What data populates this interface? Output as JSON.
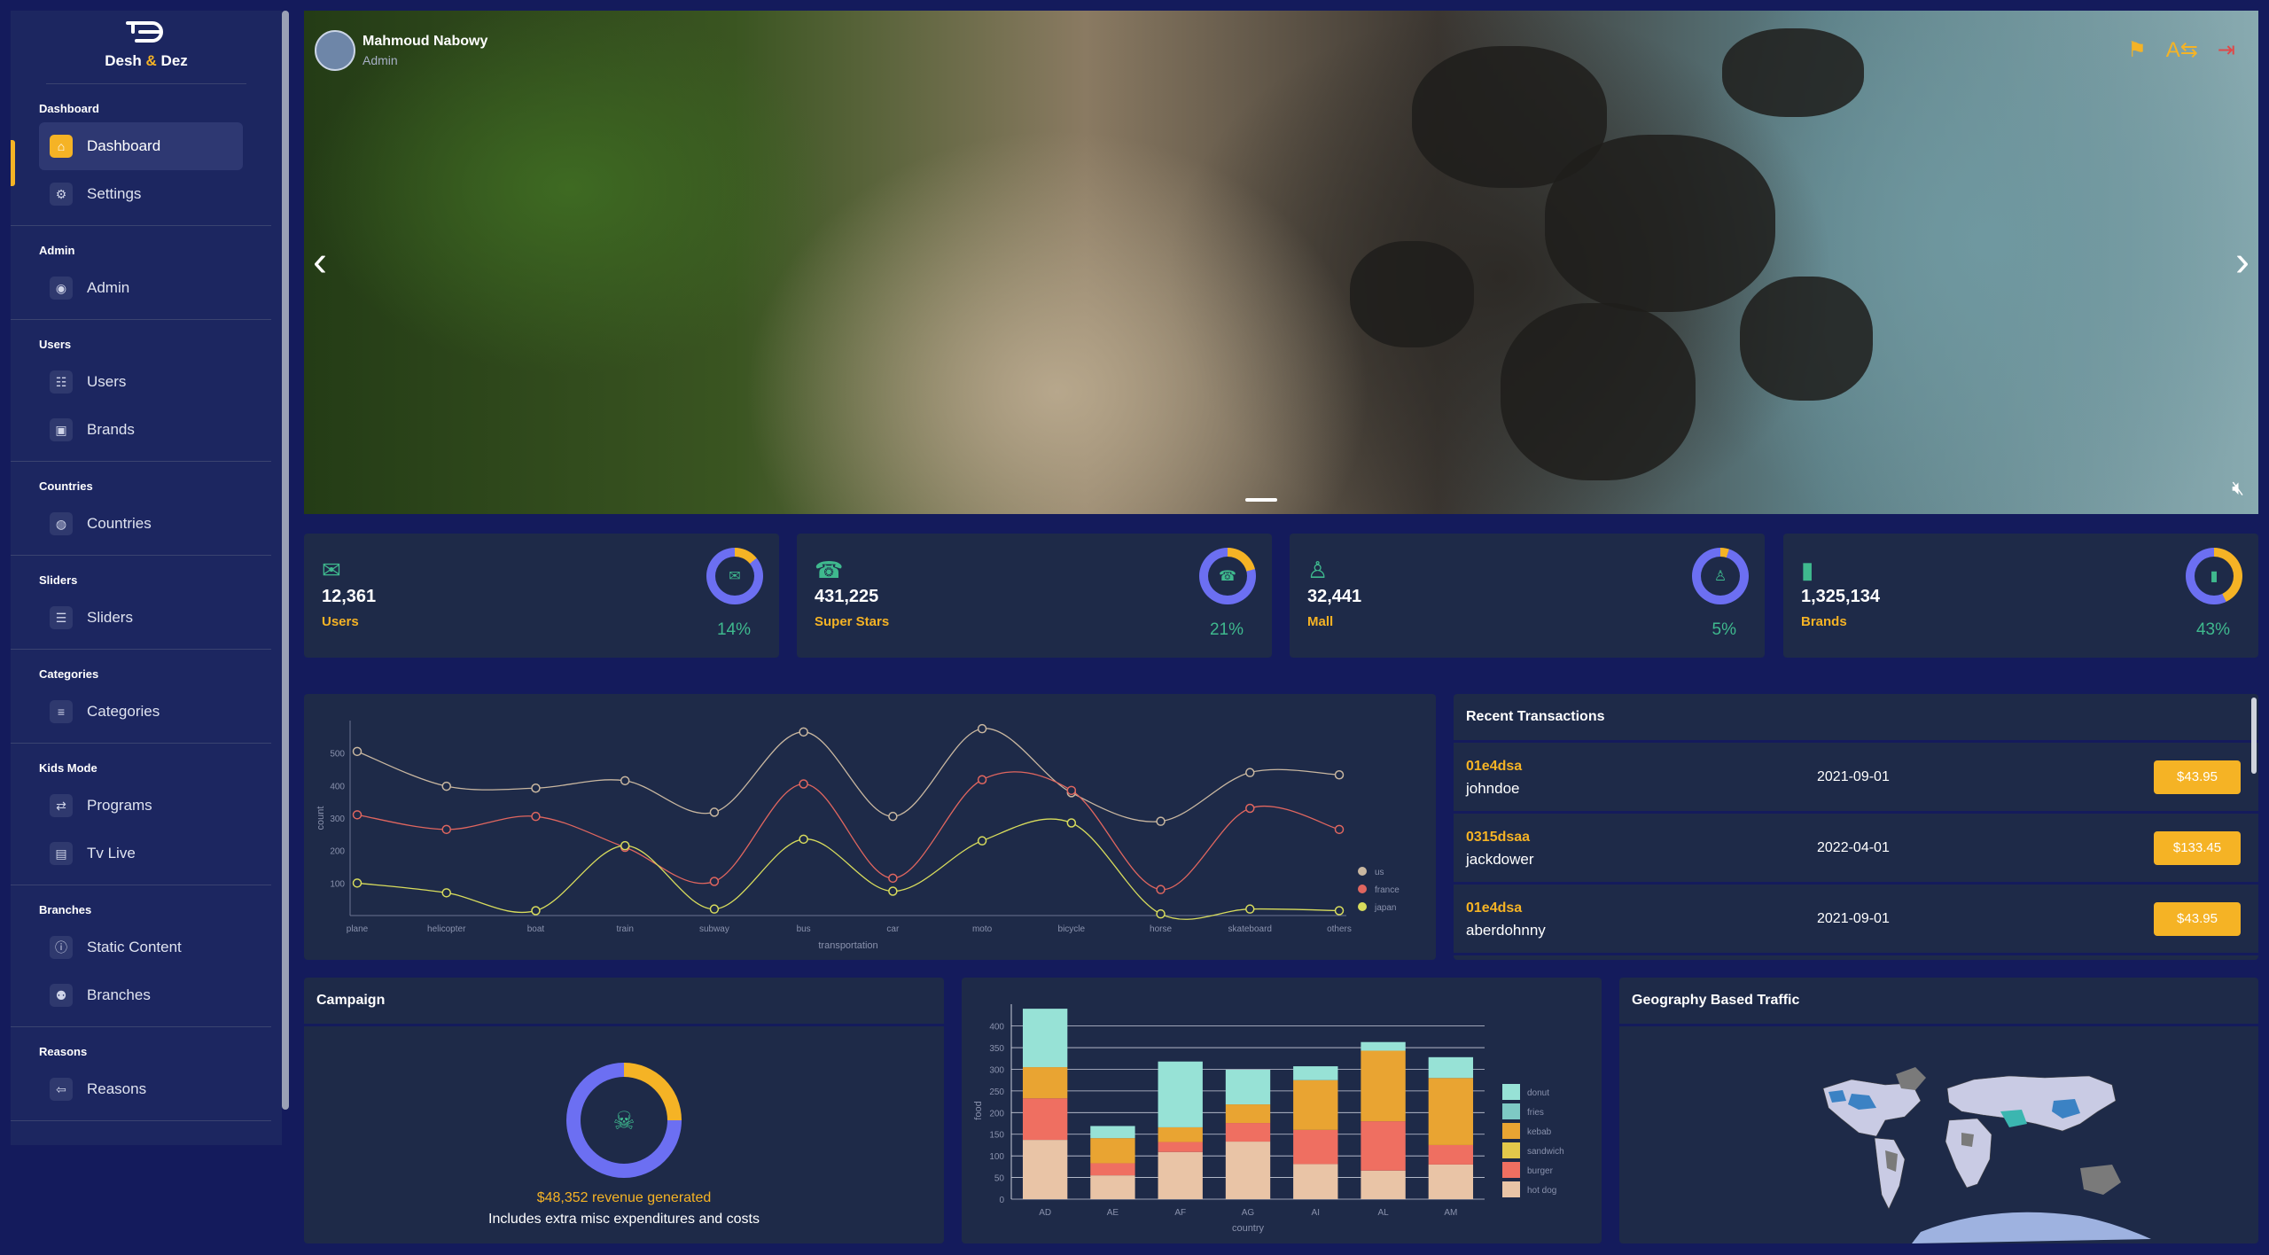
{
  "brand": {
    "name_a": "Desh",
    "amp": "&",
    "name_b": "Dez"
  },
  "sidebar": {
    "sections": [
      {
        "title": "Dashboard",
        "items": [
          {
            "label": "Dashboard",
            "icon": "home-icon"
          },
          {
            "label": "Settings",
            "icon": "gears-icon"
          }
        ]
      },
      {
        "title": "Admin",
        "items": [
          {
            "label": "Admin",
            "icon": "user-icon"
          }
        ]
      },
      {
        "title": "Users",
        "items": [
          {
            "label": "Users",
            "icon": "users-icon"
          },
          {
            "label": "Brands",
            "icon": "brands-icon"
          }
        ]
      },
      {
        "title": "Countries",
        "items": [
          {
            "label": "Countries",
            "icon": "globe-icon"
          }
        ]
      },
      {
        "title": "Sliders",
        "items": [
          {
            "label": "Sliders",
            "icon": "sliders-icon"
          }
        ]
      },
      {
        "title": "Categories",
        "items": [
          {
            "label": "Categories",
            "icon": "list-icon"
          }
        ]
      },
      {
        "title": "Kids Mode",
        "items": [
          {
            "label": "Programs",
            "icon": "programs-icon"
          },
          {
            "label": "Tv Live",
            "icon": "tv-icon"
          }
        ]
      },
      {
        "title": "Branches",
        "items": [
          {
            "label": "Static Content",
            "icon": "info-icon"
          },
          {
            "label": "Branches",
            "icon": "branches-icon"
          }
        ]
      },
      {
        "title": "Reasons",
        "items": [
          {
            "label": "Reasons",
            "icon": "reasons-icon"
          }
        ]
      }
    ]
  },
  "header": {
    "user_name": "Mahmoud Nabowy",
    "user_role": "Admin"
  },
  "stats": [
    {
      "value": "12,361",
      "label": "Users",
      "percent": "14%",
      "fraction": 0.14,
      "icon": "mail-icon"
    },
    {
      "value": "431,225",
      "label": "Super Stars",
      "percent": "21%",
      "fraction": 0.21,
      "icon": "phone-icon"
    },
    {
      "value": "32,441",
      "label": "Mall",
      "percent": "5%",
      "fraction": 0.05,
      "icon": "person-add-icon"
    },
    {
      "value": "1,325,134",
      "label": "Brands",
      "percent": "43%",
      "fraction": 0.43,
      "icon": "traffic-icon"
    }
  ],
  "transactions": {
    "title": "Recent Transactions",
    "rows": [
      {
        "id": "01e4dsa",
        "user": "johndoe",
        "date": "2021-09-01",
        "cost": "$43.95"
      },
      {
        "id": "0315dsaa",
        "user": "jackdower",
        "date": "2022-04-01",
        "cost": "$133.45"
      },
      {
        "id": "01e4dsa",
        "user": "aberdohnny",
        "date": "2021-09-01",
        "cost": "$43.95"
      }
    ]
  },
  "campaign": {
    "title": "Campaign",
    "revenue": "$48,352 revenue generated",
    "subtitle": "Includes extra misc expenditures and costs",
    "fraction": 0.25
  },
  "geo": {
    "title": "Geography Based Traffic"
  },
  "colors": {
    "accent": "#f5b325",
    "green": "#3fb98e",
    "ring": "#6c6ff2",
    "panel": "#1e2a48"
  },
  "chart_data": [
    {
      "type": "line",
      "xlabel": "transportation",
      "ylabel": "count",
      "categories": [
        "plane",
        "helicopter",
        "boat",
        "train",
        "subway",
        "bus",
        "car",
        "moto",
        "bicycle",
        "horse",
        "skateboard",
        "others"
      ],
      "yticks": [
        100,
        200,
        300,
        400,
        500
      ],
      "ylim": [
        0,
        600
      ],
      "legend_position": "right",
      "series": [
        {
          "name": "us",
          "color": "#c9b7a0",
          "values": [
            505,
            398,
            392,
            415,
            318,
            565,
            305,
            575,
            378,
            290,
            440,
            433
          ]
        },
        {
          "name": "france",
          "color": "#e0665f",
          "values": [
            310,
            265,
            305,
            210,
            105,
            405,
            115,
            418,
            385,
            80,
            330,
            265
          ]
        },
        {
          "name": "japan",
          "color": "#d8dc5c",
          "values": [
            100,
            70,
            15,
            215,
            20,
            235,
            75,
            230,
            285,
            5,
            20,
            15
          ]
        }
      ]
    },
    {
      "type": "bar",
      "stacked": true,
      "xlabel": "country",
      "ylabel": "food",
      "categories": [
        "AD",
        "AE",
        "AF",
        "AG",
        "AI",
        "AL",
        "AM"
      ],
      "yticks": [
        0,
        50,
        100,
        150,
        200,
        250,
        300,
        350,
        400
      ],
      "ylim": [
        0,
        430
      ],
      "legend_position": "right",
      "series": [
        {
          "name": "hot dog",
          "color": "#e9c4a6",
          "values": [
            137,
            55,
            109,
            133,
            81,
            66,
            80
          ]
        },
        {
          "name": "burger",
          "color": "#ef6f61",
          "values": [
            96,
            28,
            23,
            43,
            79,
            114,
            45
          ]
        },
        {
          "name": "sandwich",
          "color": "#e3c84a",
          "values": [
            0,
            0,
            0,
            0,
            0,
            0,
            0
          ]
        },
        {
          "name": "kebab",
          "color": "#e9a432",
          "values": [
            72,
            58,
            34,
            43,
            115,
            163,
            155
          ]
        },
        {
          "name": "fries",
          "color": "#7ec9c4",
          "values": [
            0,
            0,
            0,
            0,
            0,
            0,
            0
          ]
        },
        {
          "name": "donut",
          "color": "#97e2d6",
          "values": [
            135,
            28,
            152,
            80,
            32,
            20,
            48
          ]
        }
      ]
    }
  ]
}
